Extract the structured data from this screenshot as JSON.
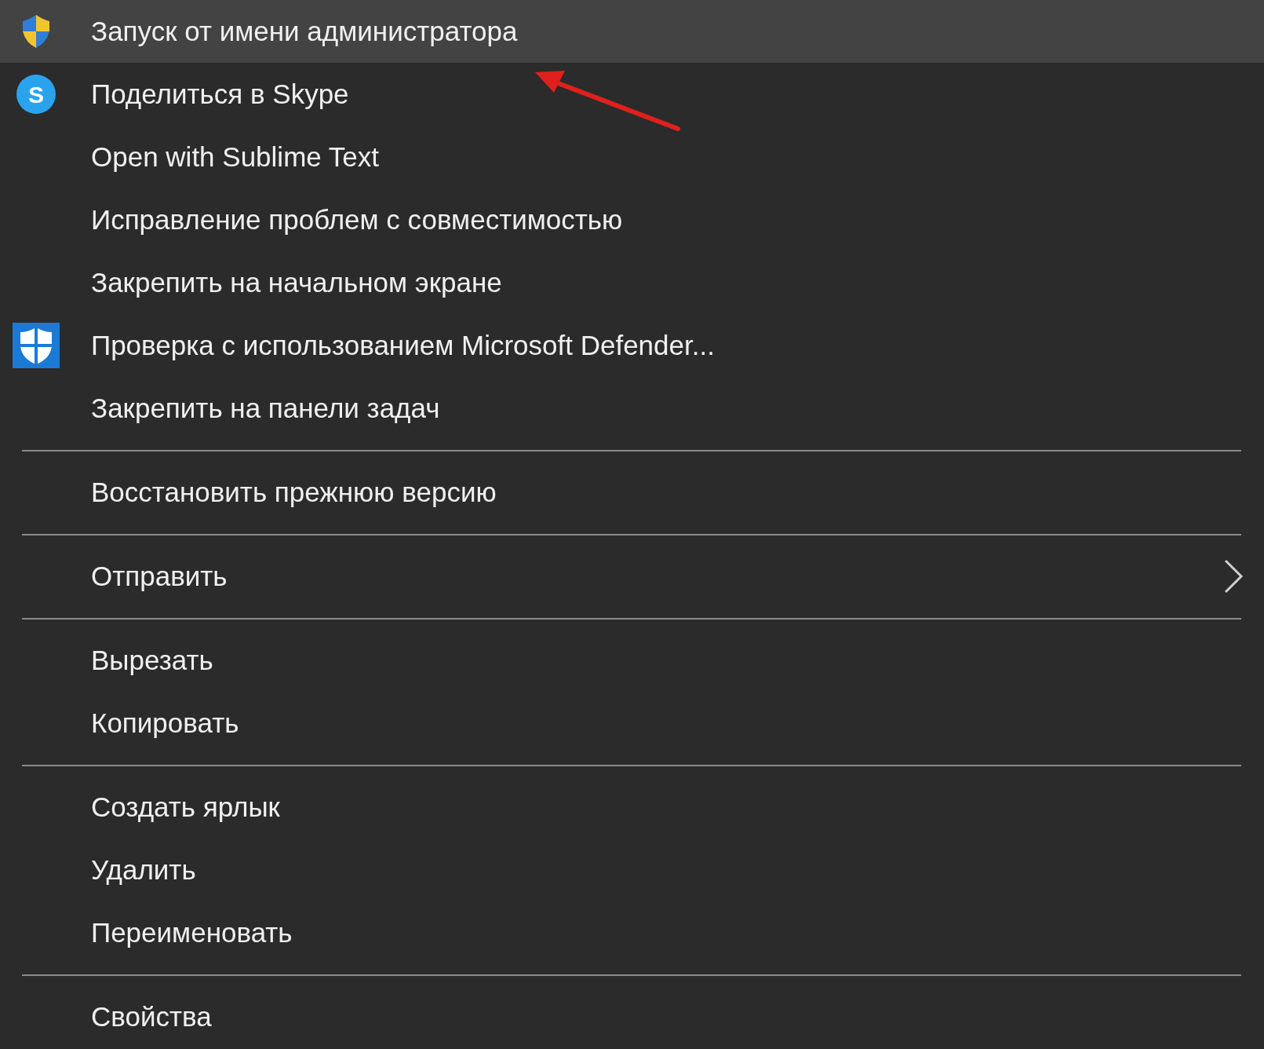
{
  "menu": {
    "sections": [
      [
        {
          "label": "Запуск от имени администратора",
          "kind": "uac",
          "selected": true,
          "has_submenu": false
        },
        {
          "label": "Поделиться в Skype",
          "kind": "chat",
          "icon_letter": "S",
          "selected": false,
          "has_submenu": false
        },
        {
          "label": "Open with Sublime Text",
          "kind": "plain",
          "selected": false,
          "has_submenu": false
        },
        {
          "label": "Исправление проблем с совместимостью",
          "kind": "plain",
          "selected": false,
          "has_submenu": false
        },
        {
          "label": "Закрепить на начальном экране",
          "kind": "plain",
          "selected": false,
          "has_submenu": false
        },
        {
          "label": "Проверка с использованием Microsoft Defender...",
          "kind": "defender",
          "selected": false,
          "has_submenu": false
        },
        {
          "label": "Закрепить на панели задач",
          "kind": "plain",
          "selected": false,
          "has_submenu": false
        }
      ],
      [
        {
          "label": "Восстановить прежнюю версию",
          "kind": "plain",
          "selected": false,
          "has_submenu": false
        }
      ],
      [
        {
          "label": "Отправить",
          "kind": "plain",
          "selected": false,
          "has_submenu": true
        }
      ],
      [
        {
          "label": "Вырезать",
          "kind": "plain",
          "selected": false,
          "has_submenu": false
        },
        {
          "label": "Копировать",
          "kind": "plain",
          "selected": false,
          "has_submenu": false
        }
      ],
      [
        {
          "label": "Создать ярлык",
          "kind": "plain",
          "selected": false,
          "has_submenu": false
        },
        {
          "label": "Удалить",
          "kind": "plain",
          "selected": false,
          "has_submenu": false
        },
        {
          "label": "Переименовать",
          "kind": "plain",
          "selected": false,
          "has_submenu": false
        }
      ],
      [
        {
          "label": "Свойства",
          "kind": "plain",
          "selected": false,
          "has_submenu": false
        }
      ]
    ]
  }
}
